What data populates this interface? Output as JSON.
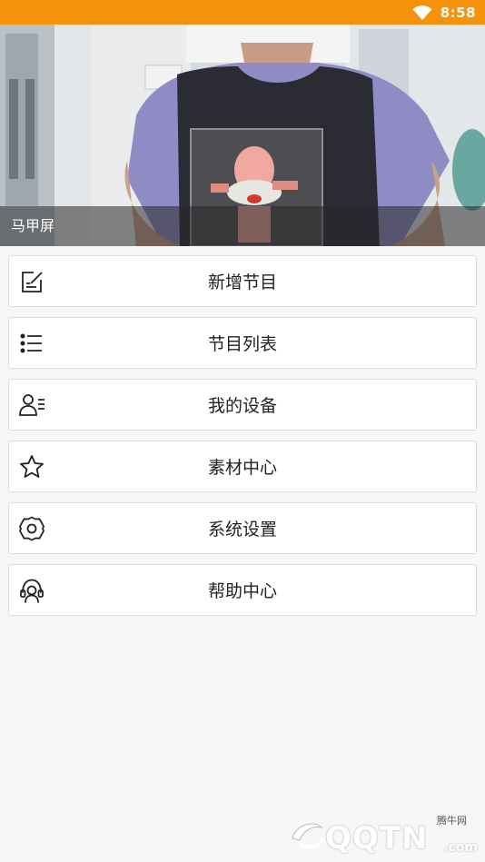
{
  "status_bar": {
    "time": "8:58",
    "background": "#f5910a"
  },
  "banner": {
    "caption": "马甲屏"
  },
  "menu": {
    "items": [
      {
        "label": "新增节目",
        "icon": "edit-icon"
      },
      {
        "label": "节目列表",
        "icon": "list-icon"
      },
      {
        "label": "我的设备",
        "icon": "user-list-icon"
      },
      {
        "label": "素材中心",
        "icon": "star-icon"
      },
      {
        "label": "系统设置",
        "icon": "gear-icon"
      },
      {
        "label": "帮助中心",
        "icon": "headset-icon"
      }
    ]
  },
  "watermark": {
    "brand": "QQTN",
    "small": "腾牛网",
    "suffix": ".com"
  }
}
